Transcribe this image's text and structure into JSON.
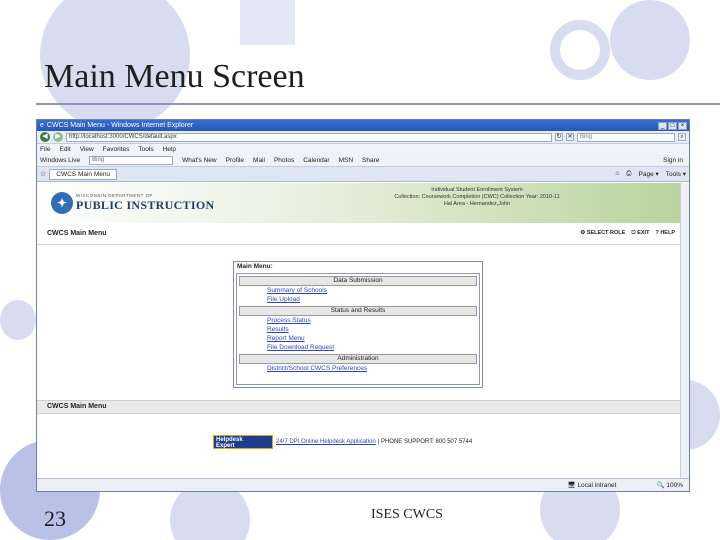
{
  "slide": {
    "title": "Main Menu Screen",
    "number": "23",
    "footer": "ISES CWCS"
  },
  "browser": {
    "window_title": "CWCS Main Menu - Windows Internet Explorer",
    "url": "http://localhost:3000/CWCS/default.aspx",
    "search_placeholder": "Bing",
    "menu": [
      "File",
      "Edit",
      "View",
      "Favorites",
      "Tools",
      "Help"
    ],
    "toolbar": {
      "windows_live": "Windows Live",
      "search_value": "Bing",
      "items": [
        "What's New",
        "Profile",
        "Mail",
        "Photos",
        "Calendar",
        "MSN",
        "Share"
      ],
      "sign_in": "Sign in"
    },
    "tab_label": "CWCS Main Menu",
    "tab_tools": [
      "Page ▾",
      "Tools ▾"
    ],
    "status": {
      "zone": "Local intranet",
      "zoom": "100%"
    }
  },
  "page": {
    "header": {
      "logo_dept": "WISCONSIN DEPARTMENT OF",
      "logo_name": "PUBLIC INSTRUCTION",
      "system_name": "Individual Student Enrollment System",
      "collection_line": "Collection: Coursework Completion (CWC) Collection Year: 2010-11",
      "user_line": "Hal Area - Hernandez,John"
    },
    "section_title": "CWCS Main Menu",
    "links": {
      "select_role": "SELECT ROLE",
      "exit": "EXIT",
      "help": "HELP"
    },
    "main_menu": {
      "title": "Main Menu:",
      "sections": [
        {
          "heading": "Data Submission",
          "links": [
            "Summary of Schools",
            "File Upload"
          ]
        },
        {
          "heading": "Status and Results",
          "links": [
            "Process Status",
            "Results",
            "Report Menu",
            "File Download Request"
          ]
        },
        {
          "heading": "Administration",
          "links": [
            "District/School CWCS Preferences"
          ]
        }
      ]
    },
    "footer_bar_title": "CWCS Main Menu",
    "helpdesk": {
      "logo_line1": "Helpdesk",
      "logo_line2": "Expert",
      "link_text": "24/7 DPI Online Helpdesk Application",
      "phone_text": "| PHONE SUPPORT: 800 507 5744"
    }
  }
}
